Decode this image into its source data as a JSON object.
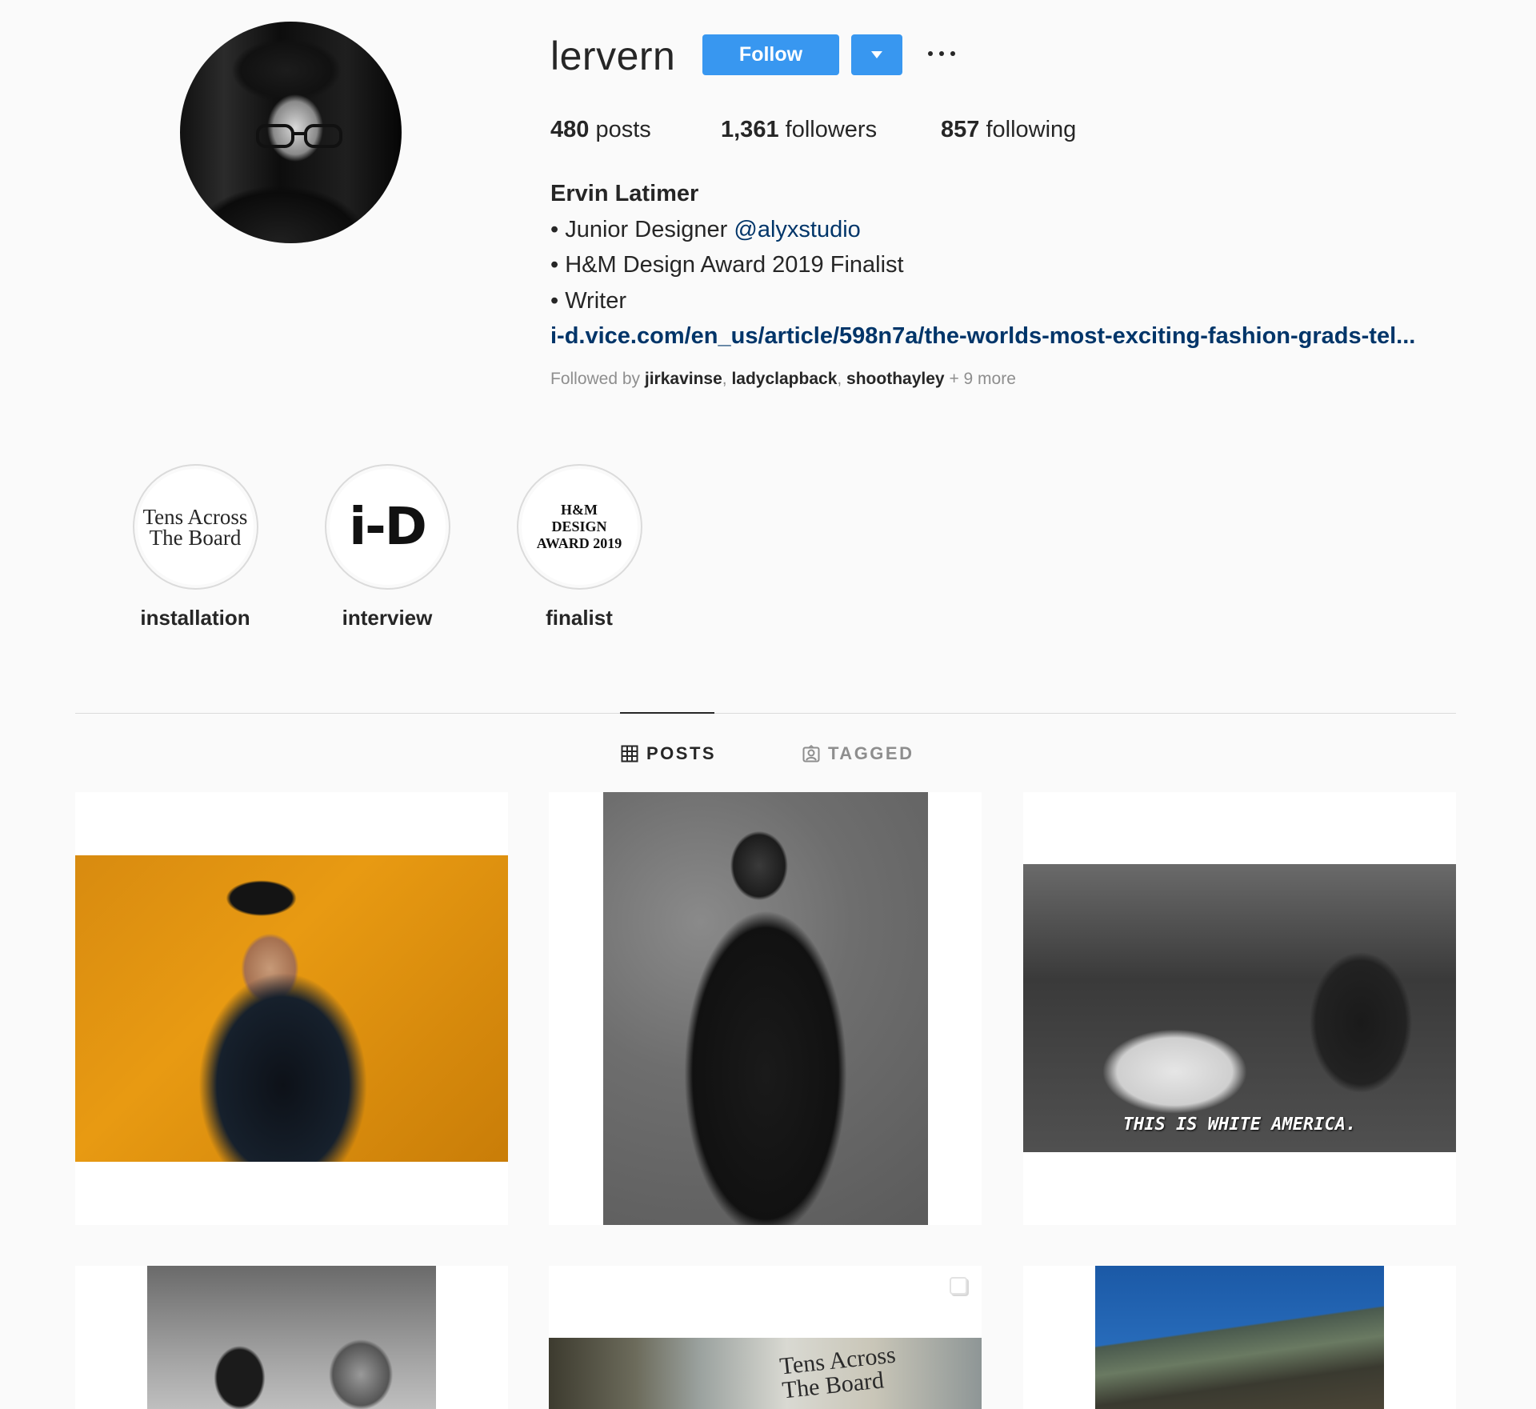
{
  "profile": {
    "username": "lervern",
    "follow_label": "Follow",
    "stats": {
      "posts_count": "480",
      "posts_label": "posts",
      "followers_count": "1,361",
      "followers_label": "followers",
      "following_count": "857",
      "following_label": "following"
    },
    "bio": {
      "full_name": "Ervin Latimer",
      "line1_prefix": "• Junior Designer ",
      "line1_mention": "@alyxstudio",
      "line2": "• H&M Design Award 2019 Finalist",
      "line3": "• Writer",
      "link": "i-d.vice.com/en_us/article/598n7a/the-worlds-most-exciting-fashion-grads-tel..."
    },
    "followed_by": {
      "prefix": "Followed by ",
      "users": [
        "jirkavinse",
        "ladyclapback",
        "shoothayley"
      ],
      "more": "+ 9 more"
    }
  },
  "highlights": [
    {
      "label": "installation",
      "cover_lines": [
        "Tens Across",
        "The Board"
      ]
    },
    {
      "label": "interview",
      "cover_text": "i-D"
    },
    {
      "label": "finalist",
      "cover_lines": [
        "H&M",
        "DESIGN",
        "AWARD 2019"
      ]
    }
  ],
  "tabs": {
    "posts": "POSTS",
    "tagged": "TAGGED",
    "active": "posts"
  },
  "posts": [
    {
      "caption": ""
    },
    {
      "caption": ""
    },
    {
      "caption": "THIS IS WHITE AMERICA."
    },
    {
      "caption": ""
    },
    {
      "caption": "Tens Across The Board",
      "sign_lines": [
        "Tens Across",
        "The Board"
      ],
      "multi": true
    },
    {
      "caption": ""
    }
  ],
  "colors": {
    "primary_button": "#3897f0",
    "link": "#003569",
    "background": "#fafafa",
    "muted_text": "#8e8e8e"
  },
  "icons": [
    "chevron-down-icon",
    "more-options-icon",
    "grid-icon",
    "tagged-icon",
    "multiple-posts-icon"
  ]
}
